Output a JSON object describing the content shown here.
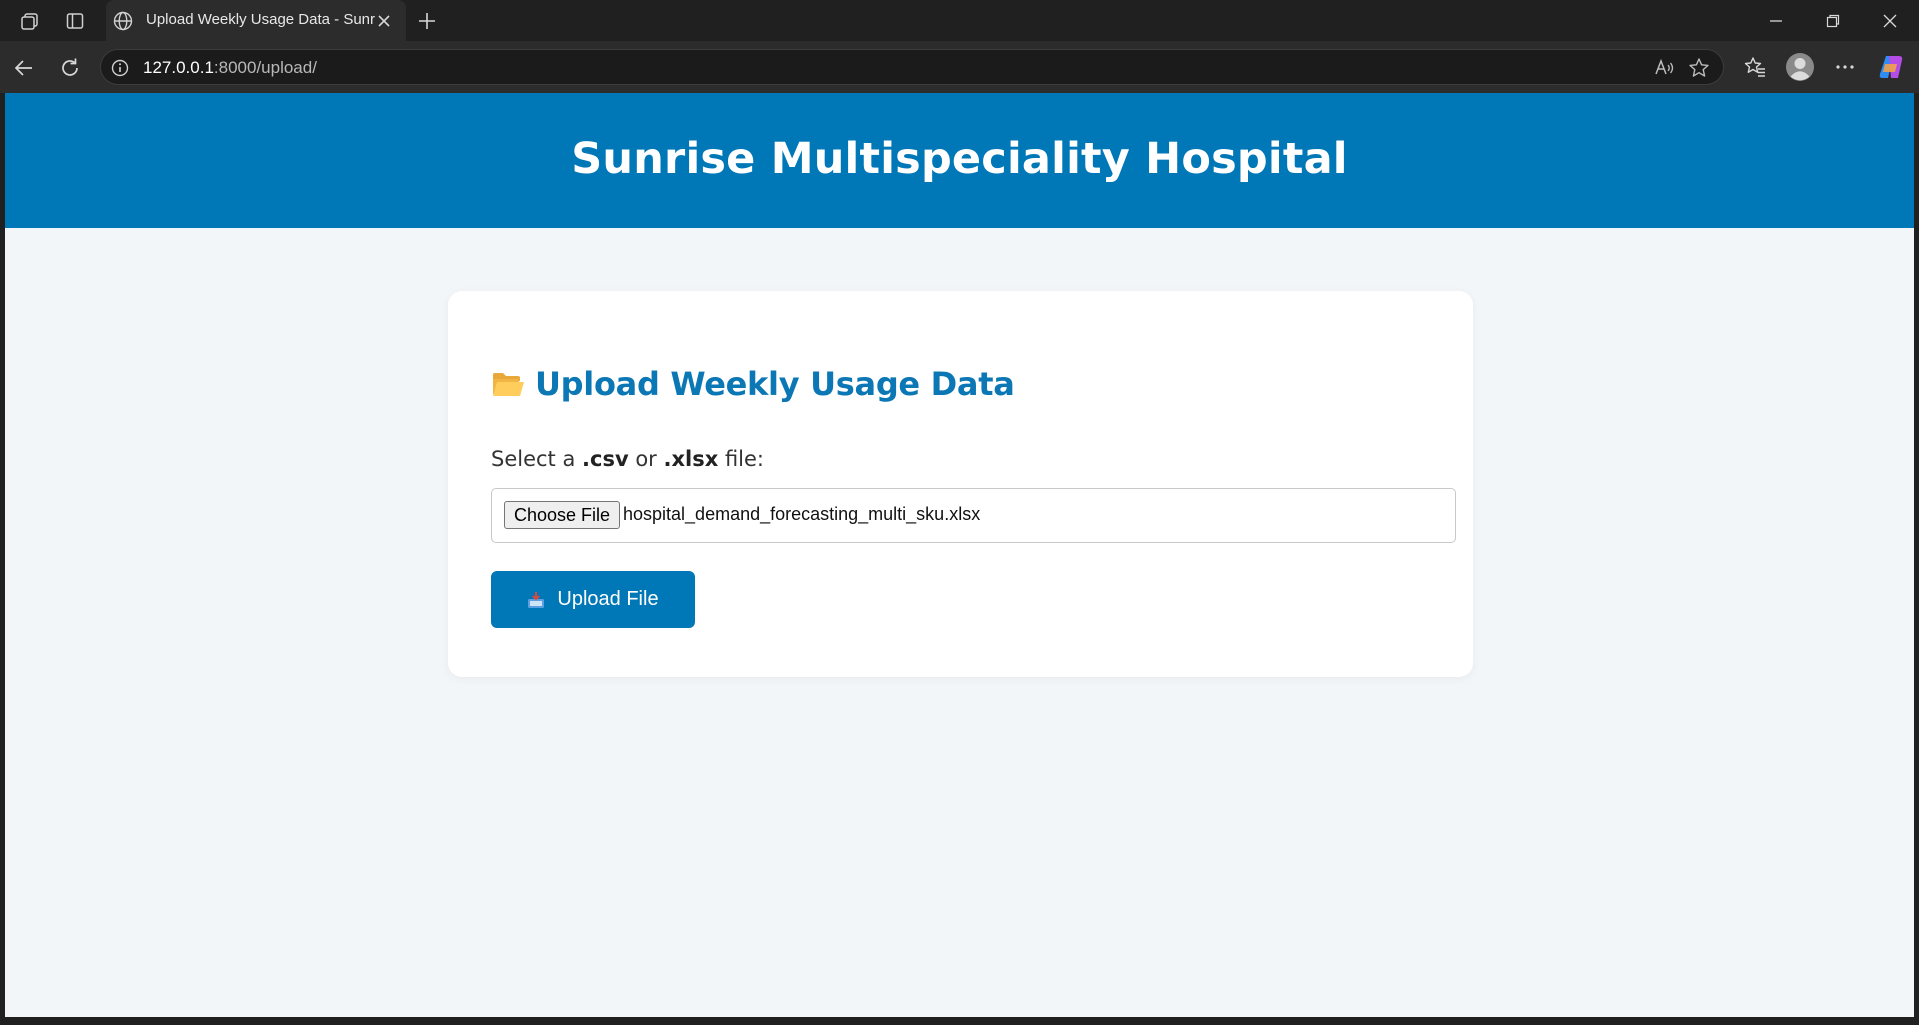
{
  "browser": {
    "tab": {
      "title": "Upload Weekly Usage Data - Sunrise Multispeciality Hospital"
    },
    "address": {
      "host": "127.0.0.1",
      "path": ":8000/upload/"
    }
  },
  "header": {
    "title": "Sunrise Multispeciality Hospital"
  },
  "upload": {
    "heading": "Upload Weekly Usage Data",
    "label_prefix": "Select a ",
    "label_ext1": ".csv",
    "label_mid": " or ",
    "label_ext2": ".xlsx",
    "label_suffix": " file:",
    "choose_label": "Choose File",
    "file_name": "hospital_demand_forecasting_multi_sku.xlsx",
    "submit_label": "Upload File"
  },
  "colors": {
    "brand": "#0077b6",
    "heading": "#0b77b4",
    "page_bg": "#f3f6f9"
  },
  "icons": {
    "heading": "open-folder-icon",
    "submit": "inbox-tray-icon"
  }
}
